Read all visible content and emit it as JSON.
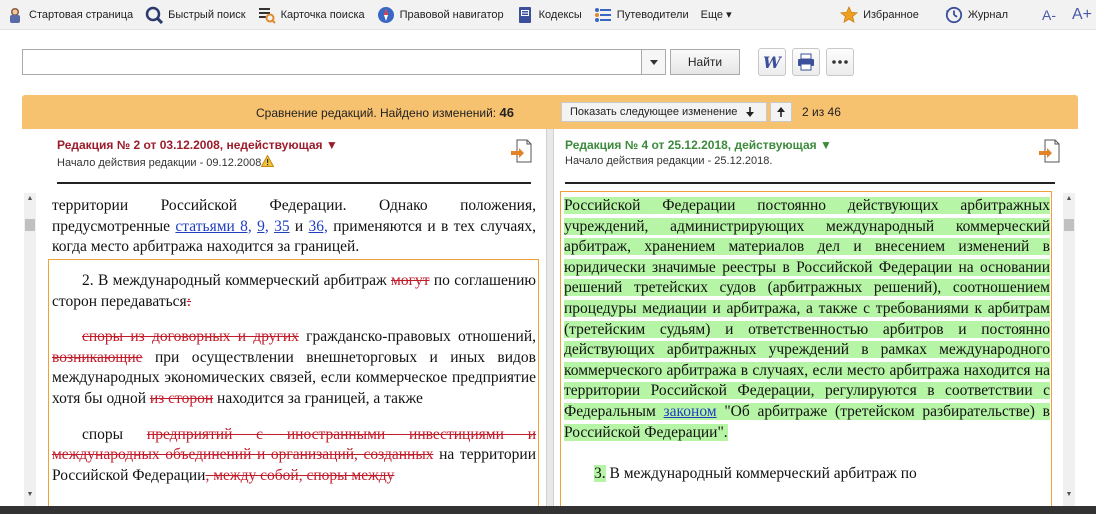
{
  "menu": {
    "items": [
      {
        "label": "Стартовая страница",
        "icon": "consultant-logo-icon"
      },
      {
        "label": "Быстрый поиск",
        "icon": "search-icon"
      },
      {
        "label": "Карточка поиска",
        "icon": "search-card-icon"
      },
      {
        "label": "Правовой навигатор",
        "icon": "compass-icon"
      },
      {
        "label": "Кодексы",
        "icon": "codex-book-icon"
      },
      {
        "label": "Путеводители",
        "icon": "guide-list-icon"
      },
      {
        "label": "Еще ▾",
        "icon": ""
      }
    ],
    "favorites": "Избранное",
    "journal": "Журнал",
    "font_smaller": "A-",
    "font_larger": "A+"
  },
  "search": {
    "value": "",
    "find_label": "Найти"
  },
  "compare": {
    "text": "Сравнение редакций. Найдено изменений:",
    "count": "46",
    "next_label": "Показать следующее изменение",
    "position": "2 из 46",
    "bar_color": "#f6c270"
  },
  "left": {
    "title": "Редакция № 2 от 03.12.2008, недействующая ▼",
    "subtitle": "Начало действия редакции - 09.12.2008",
    "title_color": "#9b1c2b"
  },
  "right": {
    "title": "Редакция № 4 от 25.12.2018, действующая ▼",
    "subtitle": "Начало действия редакции - 25.12.2018.",
    "title_color": "#3c8a3c"
  },
  "doc_left": {
    "p1_a": "территории Российской Федерации. Однако положения, предусмотренные ",
    "p1_link1": "статьями 8,",
    "p1_sp1": " ",
    "p1_link2": "9,",
    "p1_sp2": " ",
    "p1_link3": "35",
    "p1_and": " и ",
    "p1_link4": "36,",
    "p1_b": " применяются и в тех случаях, когда место арбитража находится за границей.",
    "p2_a": "2. В международный коммерческий арбитраж ",
    "p2_del1": "могут",
    "p2_b": " по соглашению сторон передаваться",
    "p2_del2": ":",
    "p3_del1": "споры из договорных и других",
    "p3_a": " гражданско-правовых отношений, ",
    "p3_del2": "возникающие",
    "p3_b": " при осуществлении внешнеторговых и иных видов международных экономических связей, если коммерческое предприятие хотя бы одной ",
    "p3_del3": "из сторон",
    "p3_c": " находится за границей, а также",
    "p4_a": "споры ",
    "p4_del1": "предприятий с иностранными инвестициями и международных объединений и организаций, созданных",
    "p4_b": " на территории Российской Федерации",
    "p4_del2": ", между собой, споры между"
  },
  "doc_right": {
    "p1_a": "Российской Федерации постоянно действующих арбитражных учреждений, администрирующих международный коммерческий арбитраж, хранением материалов дел и внесением изменений в юридически значимые реестры в Российской Федерации на основании решений третейских судов (арбитражных решений), соотношением процедуры медиации и арбитража, а также с требованиями к арбитрам (третейским судьям) и ответственностью арбитров и постоянно действующих арбитражных учреждений в рамках международного коммерческого арбитража в случаях, если место арбитража находится на территории Российской Федерации, регулируются в соответствии с Федеральным ",
    "p1_link": "законом",
    "p1_b": " \"Об арбитраже (третейском разбирательстве) в Российской Федерации\".",
    "p2_num": "3.",
    "p2_a": " В международный коммерческий арбитраж по"
  }
}
